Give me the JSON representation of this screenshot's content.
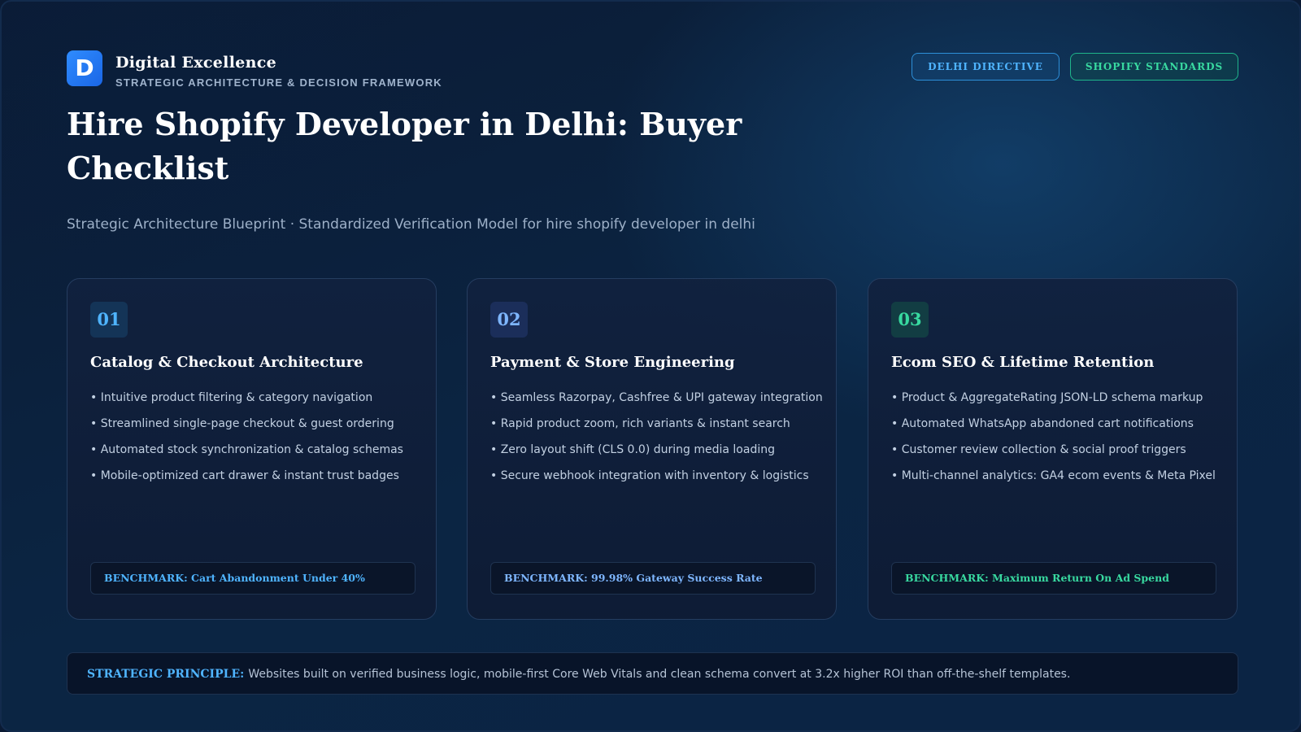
{
  "brand": {
    "logo_letter": "D",
    "name": "Digital Excellence",
    "tagline": "STRATEGIC ARCHITECTURE & DECISION FRAMEWORK"
  },
  "tags": [
    "DELHI DIRECTIVE",
    "SHOPIFY STANDARDS"
  ],
  "header": {
    "title": "Hire Shopify Developer in Delhi: Buyer Checklist",
    "subtitle": "Strategic Architecture Blueprint · Standardized Verification Model for hire shopify developer in delhi"
  },
  "cards": [
    {
      "number": "01",
      "title": "Catalog & Checkout Architecture",
      "bullets": [
        "• Intuitive product filtering & category navigation",
        "• Streamlined single-page checkout & guest ordering",
        "• Automated stock synchronization & catalog schemas",
        "• Mobile-optimized cart drawer & instant trust badges"
      ],
      "benchmark": "BENCHMARK: Cart Abandonment Under 40%"
    },
    {
      "number": "02",
      "title": "Payment & Store Engineering",
      "bullets": [
        "• Seamless Razorpay, Cashfree & UPI gateway integration",
        "• Rapid product zoom, rich variants & instant search",
        "• Zero layout shift (CLS 0.0) during media loading",
        "• Secure webhook integration with inventory & logistics"
      ],
      "benchmark": "BENCHMARK: 99.98% Gateway Success Rate"
    },
    {
      "number": "03",
      "title": "Ecom SEO & Lifetime Retention",
      "bullets": [
        "• Product & AggregateRating JSON-LD schema markup",
        "• Automated WhatsApp abandoned cart notifications",
        "• Customer review collection & social proof triggers",
        "• Multi-channel analytics: GA4 ecom events & Meta Pixel"
      ],
      "benchmark": "BENCHMARK: Maximum Return On Ad Spend"
    }
  ],
  "principle": {
    "label": "STRATEGIC PRINCIPLE:",
    "text": "Websites built on verified business logic, mobile-first Core Web Vitals and clean schema convert at 3.2x higher ROI than off-the-shelf templates."
  },
  "colors": {
    "accent_blue": "#4fb4ff",
    "accent_periwinkle": "#7eb6ff",
    "accent_green": "#38d9a0",
    "background": "#0b1f3a"
  }
}
